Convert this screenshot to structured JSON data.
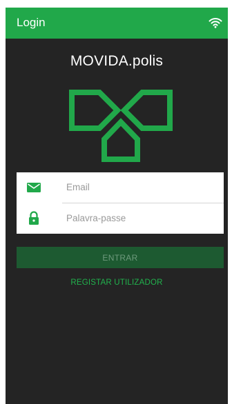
{
  "appbar": {
    "title": "Login",
    "status_icon": "wifi-icon"
  },
  "brand": {
    "title": "MOVIDA.polis",
    "logo_icon": "movida-logo-icon"
  },
  "form": {
    "email": {
      "placeholder": "Email",
      "value": "",
      "icon": "envelope-icon"
    },
    "password": {
      "placeholder": "Palavra-passe",
      "value": "",
      "icon": "lock-icon"
    }
  },
  "actions": {
    "enter_label": "ENTRAR",
    "register_label": "REGISTAR UTILIZADOR"
  },
  "colors": {
    "accent": "#21a84a",
    "background": "#242424",
    "button_disabled": "#1d5a31",
    "link": "#21b34d"
  }
}
